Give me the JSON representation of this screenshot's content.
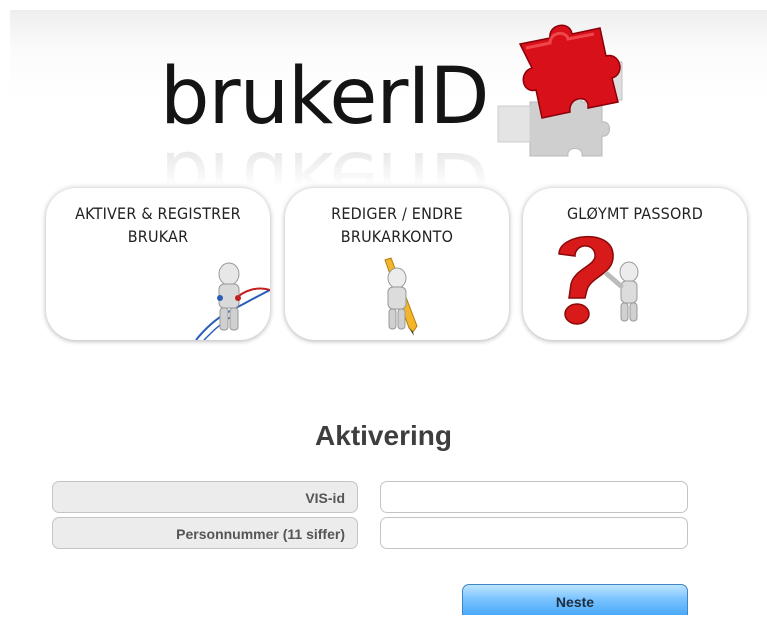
{
  "logo": {
    "text": "brukerID",
    "icon": "red-puzzle-piece-icon"
  },
  "cards": [
    {
      "title": "AKTIVER & REGISTRER\nBRUKAR",
      "icon": "person-with-cables-icon"
    },
    {
      "title": "REDIGER / ENDRE\nBRUKARKONTO",
      "icon": "person-with-pencil-icon"
    },
    {
      "title": "GLØYMT PASSORD",
      "icon": "person-with-question-mark-icon"
    }
  ],
  "form": {
    "title": "Aktivering",
    "fields": [
      {
        "label": "VIS-id",
        "value": ""
      },
      {
        "label": "Personnummer (11 siffer)",
        "value": ""
      }
    ],
    "submit_label": "Neste"
  },
  "colors": {
    "puzzle": "#d8101a",
    "button": "#4aa9f7",
    "question_mark": "#d81a1a"
  }
}
